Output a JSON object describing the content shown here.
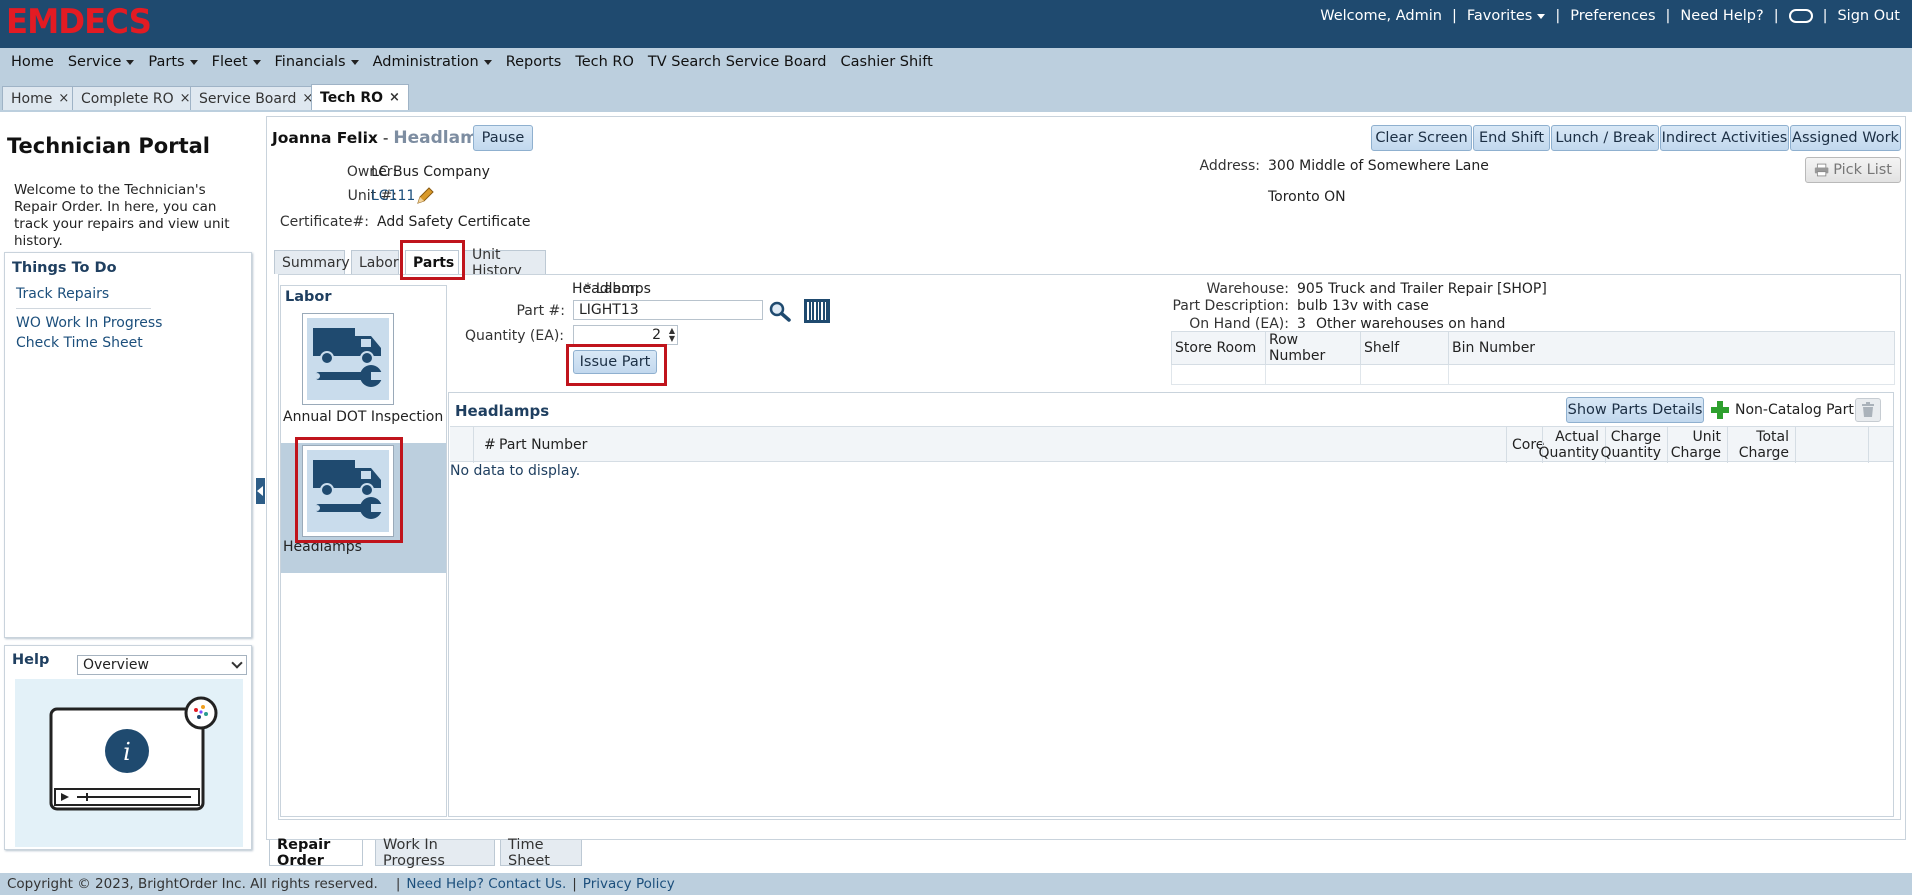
{
  "header": {
    "logo": "EMDECS",
    "welcome": "Welcome, Admin",
    "favorites": "Favorites",
    "preferences": "Preferences",
    "need_help": "Need Help?",
    "sign_out": "Sign Out",
    "separator": "|"
  },
  "menu": {
    "home": "Home",
    "service": "Service",
    "parts": "Parts",
    "fleet": "Fleet",
    "financials": "Financials",
    "administration": "Administration",
    "reports": "Reports",
    "tech_ro": "Tech RO",
    "tv_search": "TV Search Service Board",
    "cashier_shift": "Cashier Shift"
  },
  "doc_tabs": [
    {
      "label": "Home"
    },
    {
      "label": "Complete RO"
    },
    {
      "label": "Service Board"
    },
    {
      "label": "Tech RO"
    }
  ],
  "close_glyph": "×",
  "sidebar": {
    "title": "Technician Portal",
    "welcome_text": "Welcome to the Technician's Repair Order. In here, you can track your repairs and view unit history.",
    "things_heading": "Things To Do",
    "links": {
      "track_repairs": "Track Repairs",
      "wo_in_progress": "WO Work In Progress",
      "check_time_sheet": "Check Time Sheet"
    },
    "help_heading": "Help",
    "help_selected": "Overview"
  },
  "ro": {
    "technician": "Joanna Felix",
    "dash": "-",
    "repair": "Headlamps",
    "pause": "Pause",
    "actions": {
      "clear_screen": "Clear Screen",
      "end_shift": "End Shift",
      "lunch_break": "Lunch / Break",
      "indirect": "Indirect Activities",
      "assigned": "Assigned Work",
      "pick_list": "Pick List"
    },
    "owner_label": "Owner:",
    "owner": "LC Bus Company",
    "unit_label": "Unit #:",
    "unit": "LC111",
    "cert_label": "Certificate#:",
    "cert_link": "Add Safety Certificate",
    "address_label": "Address:",
    "address_line1": "300 Middle of Somewhere Lane",
    "address_line2": "Toronto ON"
  },
  "sub_tabs": {
    "summary": "Summary",
    "labor": "Labor",
    "parts": "Parts",
    "unit_history": "Unit History"
  },
  "labor_panel": {
    "heading": "Labor",
    "items": [
      {
        "label": "Annual DOT Inspection"
      },
      {
        "label": "Headlamps"
      }
    ]
  },
  "part_form": {
    "labor_label": "* Labor:",
    "labor_value": "Headlamps",
    "part_label": "Part #:",
    "part_value": "LIGHT13",
    "qty_label": "Quantity (EA):",
    "qty_value": "2",
    "issue_button": "Issue Part",
    "warehouse_label": "Warehouse:",
    "warehouse_value": "905 Truck and Trailer Repair [SHOP]",
    "desc_label": "Part Description:",
    "desc_value": "bulb 13v with case",
    "onhand_label": "On Hand (EA):",
    "onhand_value": "3",
    "other_warehouses": "Other warehouses on hand",
    "location_columns": [
      "Store Room",
      "Row Number",
      "Shelf",
      "Bin Number"
    ]
  },
  "parts_grid": {
    "title": "Headlamps",
    "show_details": "Show Parts Details",
    "non_catalog": "Non-Catalog Part",
    "col_hash": "#",
    "col_part_number": "Part Number",
    "col_core": "Core",
    "col_actual_qty": [
      "Actual",
      "Quantity"
    ],
    "col_charge_qty": [
      "Charge",
      "Quantity"
    ],
    "col_unit_charge": [
      "Unit",
      "Charge"
    ],
    "col_total_charge": [
      "Total",
      "Charge"
    ],
    "empty": "No data to display."
  },
  "bottom_tabs": {
    "repair_order": "Repair Order",
    "wip": "Work In Progress",
    "time_sheet": "Time Sheet"
  },
  "footer": {
    "copyright": "Copyright © 2023, BrightOrder Inc. All rights reserved.",
    "contact": "Need Help? Contact Us.",
    "privacy": "Privacy Policy"
  },
  "colors": {
    "header_bg": "#1f4a6f",
    "menu_bg": "#bccfde",
    "logo": "#e31b23",
    "highlight": "#c0141c"
  }
}
